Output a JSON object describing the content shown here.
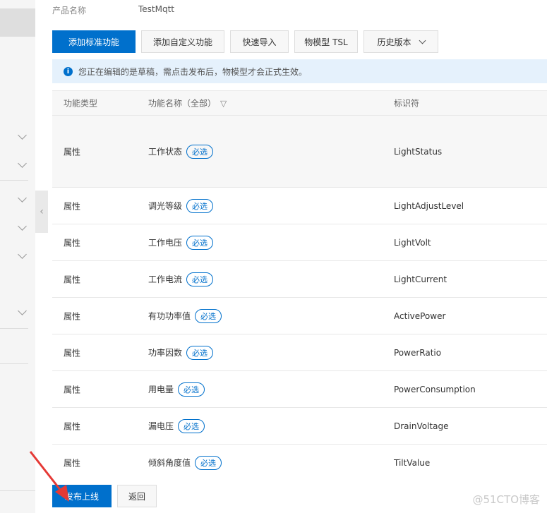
{
  "product": {
    "label": "产品名称",
    "value": "TestMqtt"
  },
  "toolbar": {
    "add_standard": "添加标准功能",
    "add_custom": "添加自定义功能",
    "quick_import": "快速导入",
    "tsl": "物模型 TSL",
    "history": "历史版本"
  },
  "notice": "您正在编辑的是草稿，需点击发布后，物模型才会正式生效。",
  "table": {
    "headers": [
      "功能类型",
      "功能名称（全部）",
      "标识符"
    ],
    "rows": [
      {
        "type": "属性",
        "name": "工作状态",
        "tag": "必选",
        "id": "LightStatus"
      },
      {
        "type": "属性",
        "name": "调光等级",
        "tag": "必选",
        "id": "LightAdjustLevel"
      },
      {
        "type": "属性",
        "name": "工作电压",
        "tag": "必选",
        "id": "LightVolt"
      },
      {
        "type": "属性",
        "name": "工作电流",
        "tag": "必选",
        "id": "LightCurrent"
      },
      {
        "type": "属性",
        "name": "有功功率值",
        "tag": "必选",
        "id": "ActivePower"
      },
      {
        "type": "属性",
        "name": "功率因数",
        "tag": "必选",
        "id": "PowerRatio"
      },
      {
        "type": "属性",
        "name": "用电量",
        "tag": "必选",
        "id": "PowerConsumption"
      },
      {
        "type": "属性",
        "name": "漏电压",
        "tag": "必选",
        "id": "DrainVoltage"
      },
      {
        "type": "属性",
        "name": "倾斜角度值",
        "tag": "必选",
        "id": "TiltValue"
      }
    ]
  },
  "footer": {
    "publish": "发布上线",
    "back": "返回"
  },
  "watermark": "@51CTO博客",
  "colors": {
    "primary": "#0070cc",
    "arrow": "#e53935"
  }
}
